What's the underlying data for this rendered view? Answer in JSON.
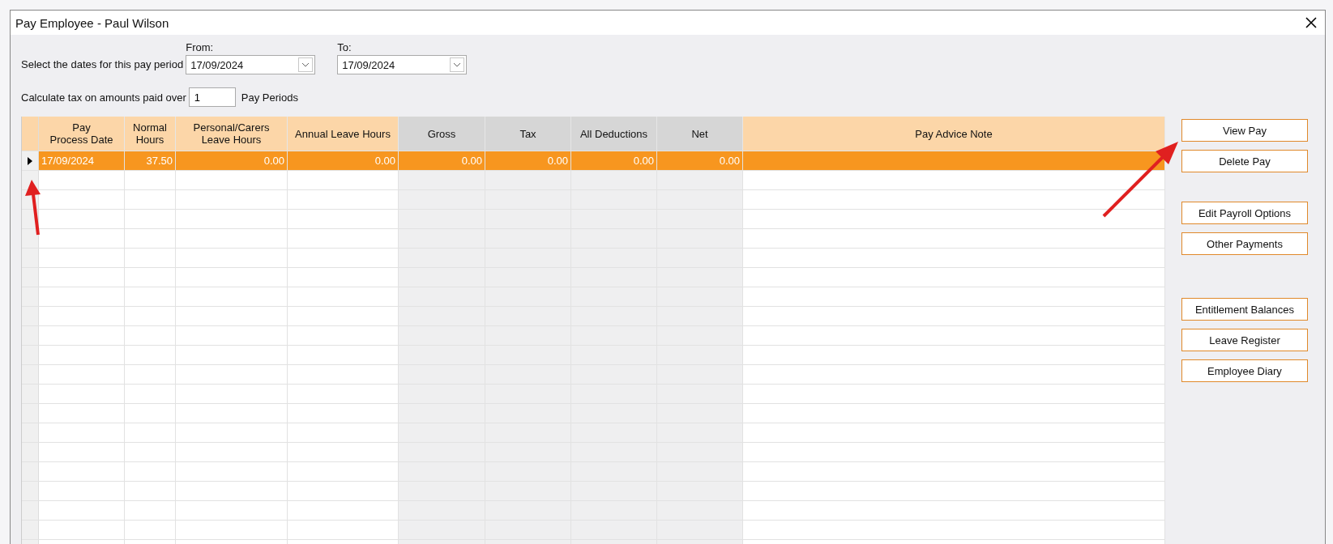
{
  "window": {
    "title": "Pay Employee - Paul Wilson"
  },
  "period": {
    "label": "Select the dates for this pay period",
    "from_label": "From:",
    "from_value": "17/09/2024",
    "to_label": "To:",
    "to_value": "17/09/2024"
  },
  "tax": {
    "label": "Calculate tax on amounts paid over",
    "value": "1",
    "suffix": "Pay Periods"
  },
  "table": {
    "columns": [
      {
        "label": "Pay\nProcess Date",
        "readonly": false
      },
      {
        "label": "Normal\nHours",
        "readonly": false
      },
      {
        "label": "Personal/Carers\nLeave Hours",
        "readonly": false
      },
      {
        "label": "Annual Leave Hours",
        "readonly": false
      },
      {
        "label": "Gross",
        "readonly": true
      },
      {
        "label": "Tax",
        "readonly": true
      },
      {
        "label": "All Deductions",
        "readonly": true
      },
      {
        "label": "Net",
        "readonly": true
      },
      {
        "label": "Pay Advice Note",
        "readonly": false
      }
    ],
    "rows": [
      {
        "selected": true,
        "cells": [
          "17/09/2024",
          "37.50",
          "0.00",
          "0.00",
          "0.00",
          "0.00",
          "0.00",
          "0.00",
          ""
        ]
      }
    ]
  },
  "buttons": [
    "View Pay",
    "Delete Pay",
    "Edit Payroll Options",
    "Other Payments",
    "Entitlement Balances",
    "Leave Register",
    "Employee Diary"
  ]
}
